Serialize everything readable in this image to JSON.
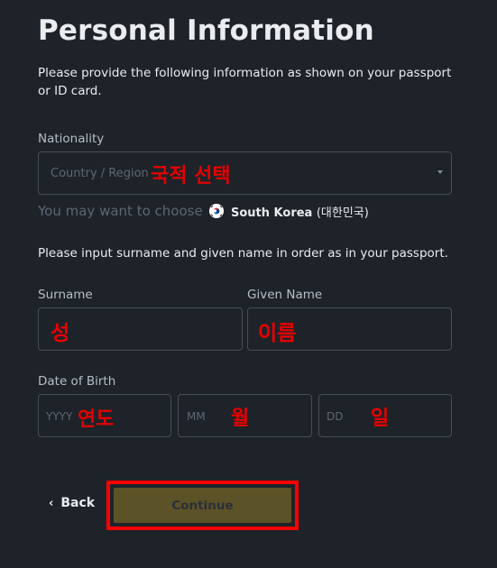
{
  "page": {
    "title": "Personal Information",
    "intro": "Please provide the following information as shown on your passport or ID card."
  },
  "nationality": {
    "label": "Nationality",
    "placeholder": "Country / Region",
    "annotation": "국적 선택",
    "suggest_prefix": "You may want to choose",
    "suggest_country": "South Korea",
    "suggest_native": "(대한민국)",
    "flag_icon": "south-korea-flag-icon"
  },
  "name": {
    "note": "Please input surname and given name in order as in your passport.",
    "surname_label": "Surname",
    "surname_annotation": "성",
    "given_label": "Given Name",
    "given_annotation": "이름"
  },
  "dob": {
    "label": "Date of Birth",
    "year_placeholder": "YYYY",
    "year_annotation": "연도",
    "month_placeholder": "MM",
    "month_annotation": "월",
    "day_placeholder": "DD",
    "day_annotation": "일"
  },
  "actions": {
    "back_label": "Back",
    "back_icon": "chevron-left-icon",
    "continue_label": "Continue"
  },
  "colors": {
    "background": "#1e2329",
    "annotation": "#e60000",
    "continue_bg": "#5c5227",
    "highlight_border": "#ff0000"
  }
}
